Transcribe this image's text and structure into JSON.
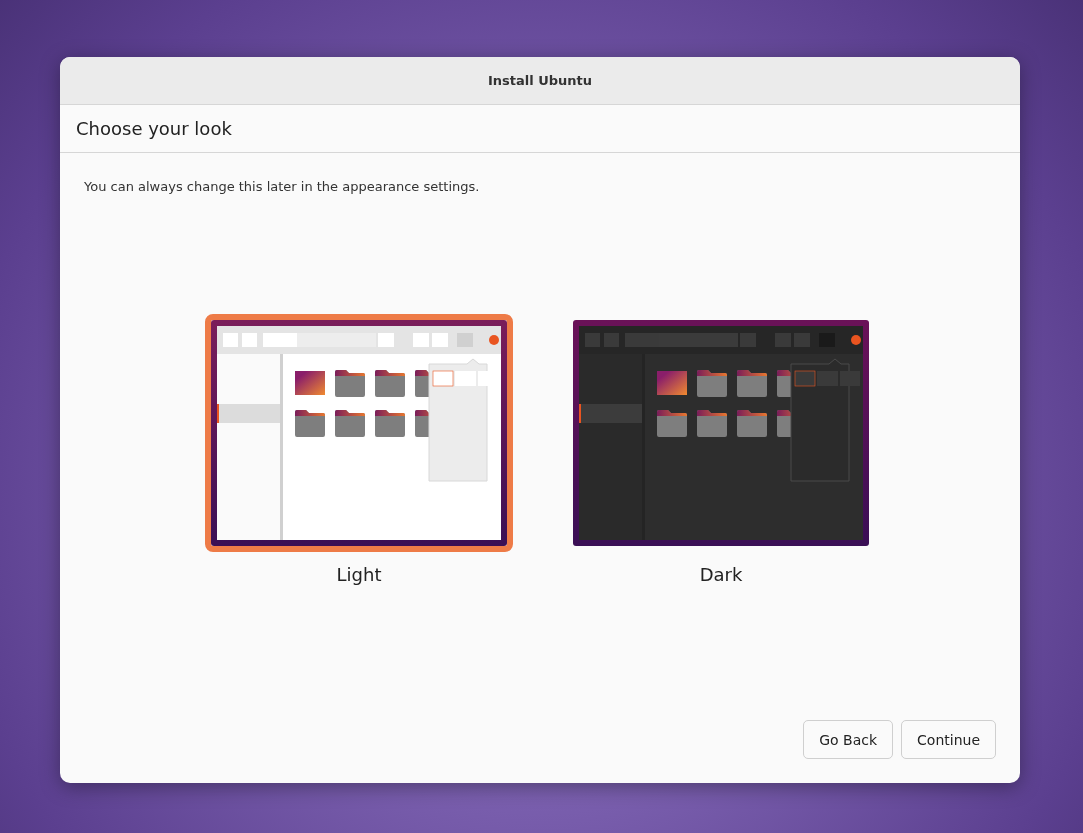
{
  "window": {
    "title": "Install Ubuntu"
  },
  "page": {
    "heading": "Choose your look",
    "description": "You can always change this later in the appearance settings."
  },
  "themes": [
    {
      "kind": "light",
      "label": "Light",
      "selected": true
    },
    {
      "kind": "dark",
      "label": "Dark",
      "selected": false
    }
  ],
  "buttons": [
    "Go Back",
    "Continue"
  ]
}
